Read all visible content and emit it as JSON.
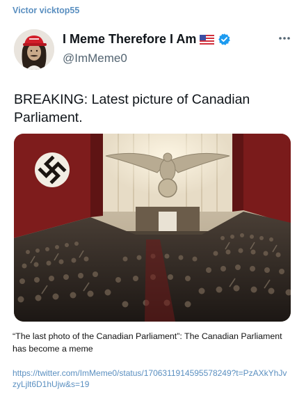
{
  "message": {
    "sender_name": "Victor vicktop55",
    "caption": "“The last photo of the Canadian Parliament”: The Canadian Parliament has become a meme",
    "link_url": "https://twitter.com/ImMeme0/status/1706311914595578249?t=PzAXkYhJvzyLjlt6D1hUjw&s=19"
  },
  "tweet": {
    "display_name": "I Meme Therefore I Am",
    "name_emoji_icon": "us-flag-icon",
    "verified_icon": "verified-badge-icon",
    "handle": "@ImMeme0",
    "more_icon": "more-options-icon",
    "text": "BREAKING: Latest picture of Canadian Parliament.",
    "media_description_icon": "assembly-hall-photo"
  },
  "colors": {
    "sender_name": "#5a8fc0",
    "link": "#5a8fc0",
    "verified": "#1d9bf0",
    "handle": "#536471",
    "text": "#0f1419"
  }
}
